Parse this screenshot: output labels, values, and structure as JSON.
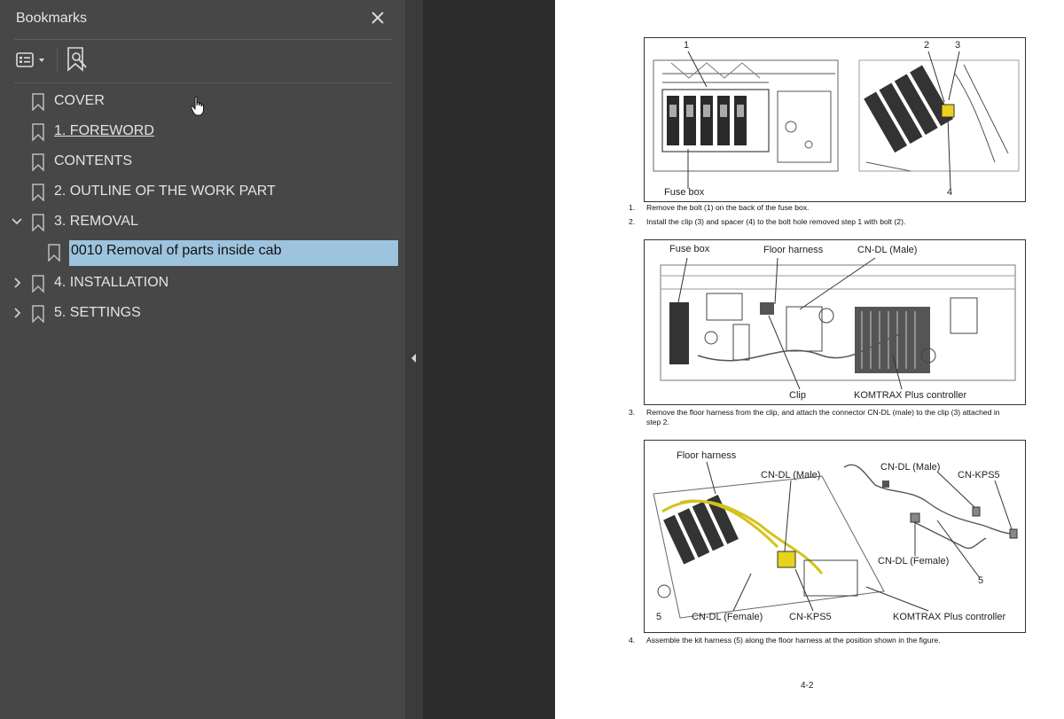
{
  "sidebar": {
    "title": "Bookmarks",
    "close_icon": "close-icon",
    "toolbar": {
      "options_icon": "bookmark-options-icon",
      "find_icon": "find-current-bookmark-icon"
    },
    "items": [
      {
        "label": "COVER",
        "expanded": null,
        "selected": false,
        "underline": false,
        "level": 0
      },
      {
        "label": "1. FOREWORD",
        "expanded": null,
        "selected": false,
        "underline": true,
        "level": 0
      },
      {
        "label": "CONTENTS",
        "expanded": null,
        "selected": false,
        "underline": false,
        "level": 0
      },
      {
        "label": "2. OUTLINE OF THE WORK PART",
        "expanded": null,
        "selected": false,
        "underline": false,
        "level": 0
      },
      {
        "label": "3. REMOVAL",
        "expanded": true,
        "selected": false,
        "underline": false,
        "level": 0
      },
      {
        "label": "0010 Removal of parts inside cab",
        "expanded": null,
        "selected": true,
        "underline": false,
        "level": 1
      },
      {
        "label": "4. INSTALLATION",
        "expanded": false,
        "selected": false,
        "underline": false,
        "level": 0
      },
      {
        "label": "5. SETTINGS",
        "expanded": false,
        "selected": false,
        "underline": false,
        "level": 0
      }
    ],
    "selection_color": "#9dc3de"
  },
  "splitter": {
    "collapse_icon": "collapse-left-arrow-icon"
  },
  "document": {
    "figure1": {
      "callouts": [
        "1",
        "2",
        "3",
        "4"
      ],
      "label_fuse_box": "Fuse box"
    },
    "step1": {
      "num": "1.",
      "text": "Remove the bolt (1) on the back of the fuse box."
    },
    "step2": {
      "num": "2.",
      "text": "Install the clip (3) and spacer (4) to the bolt hole removed step 1 with bolt (2)."
    },
    "figure2": {
      "fuse_box": "Fuse box",
      "floor_harness": "Floor harness",
      "cn_dl_male": "CN-DL (Male)",
      "clip": "Clip",
      "komtrax": "KOMTRAX Plus controller"
    },
    "step3": {
      "num": "3.",
      "text": "Remove the floor harness from the clip, and attach the connector CN-DL (male) to the clip (3) attached in step 2."
    },
    "figure3": {
      "floor_harness": "Floor harness",
      "cn_dl_male_1": "CN-DL (Male)",
      "cn_dl_male_2": "CN-DL (Male)",
      "cn_kps5_1": "CN-KPS5",
      "cn_dl_female_1": "CN-DL (Female)",
      "callout_5a": "5",
      "callout_5b": "5",
      "cn_dl_female_2": "CN-DL (Female)",
      "cn_kps5_2": "CN-KPS5",
      "komtrax": "KOMTRAX Plus controller"
    },
    "step4": {
      "num": "4.",
      "text": "Assemble the kit harness (5) along the floor harness at the position shown in the figure."
    },
    "page_number": "4-2"
  },
  "cursor_icon": "hand-pointer-icon"
}
